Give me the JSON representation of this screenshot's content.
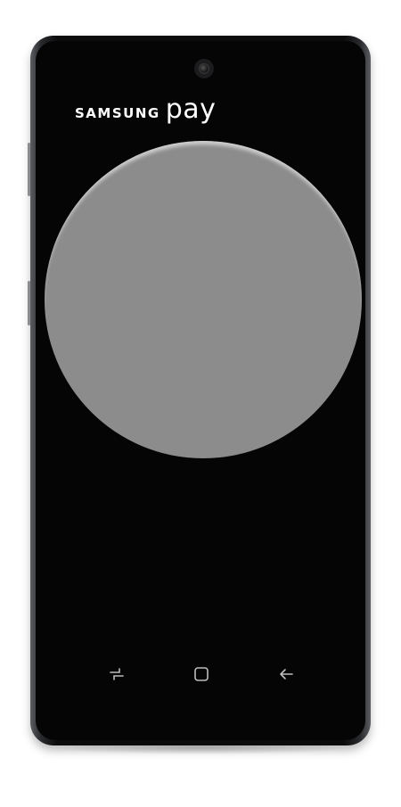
{
  "brand": {
    "samsung": "SAMSUNG",
    "pay": "pay"
  },
  "nav": {
    "recents_icon": "recent-apps-icon",
    "home_icon": "home-icon",
    "back_icon": "back-icon"
  },
  "colors": {
    "screen": "#050505",
    "circle": "#8c8c8c",
    "text": "#ffffff",
    "nav_icon": "#bdbdbd"
  }
}
